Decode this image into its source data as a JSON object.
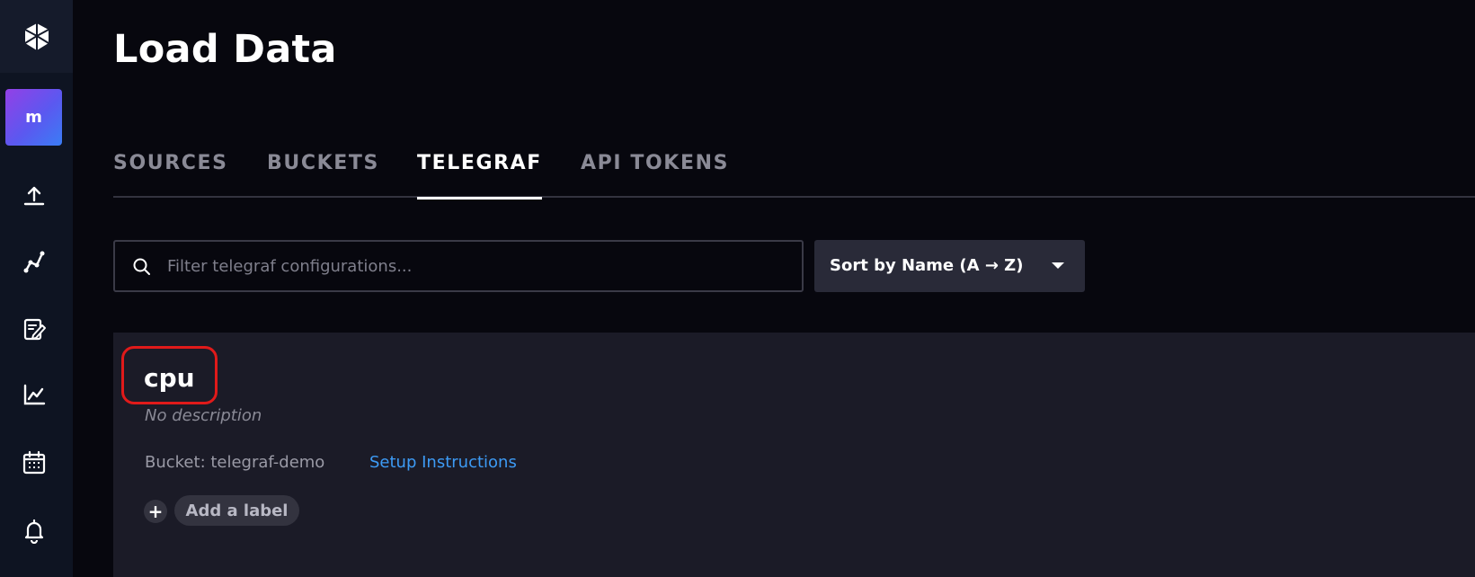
{
  "sidebar": {
    "logo": {
      "icon": "cube-logo-icon"
    },
    "org_avatar": {
      "letter": "m"
    },
    "nav_items": [
      {
        "icon": "upload-arrow-icon"
      },
      {
        "icon": "data-explorer-graph-icon"
      },
      {
        "icon": "notebook-edit-icon"
      },
      {
        "icon": "line-chart-icon"
      },
      {
        "icon": "calendar-icon"
      },
      {
        "icon": "bell-icon"
      }
    ]
  },
  "page": {
    "title": "Load Data"
  },
  "tabs": [
    {
      "label": "SOURCES",
      "active": false
    },
    {
      "label": "BUCKETS",
      "active": false
    },
    {
      "label": "TELEGRAF",
      "active": true
    },
    {
      "label": "API TOKENS",
      "active": false
    }
  ],
  "filter": {
    "placeholder": "Filter telegraf configurations...",
    "value": "",
    "icon": "search-icon"
  },
  "sort": {
    "label": "Sort by Name (A → Z)",
    "icon": "caret-down-icon"
  },
  "telegraf_card": {
    "name": "cpu",
    "description": "No description",
    "bucket": "Bucket: telegraf-demo",
    "setup_link": "Setup Instructions",
    "add_label": "Add a label",
    "add_label_icon": "+"
  },
  "colors": {
    "background": "#07070e",
    "sidebar": "#0e1422",
    "card": "#1b1b27",
    "link": "#3d9bf5",
    "highlight": "#e01a1a",
    "avatar_gradient": [
      "#9340e6",
      "#3a7df5"
    ]
  }
}
